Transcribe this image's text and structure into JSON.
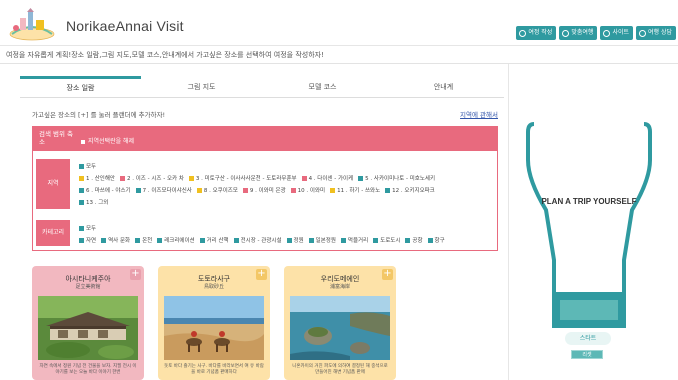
{
  "header": {
    "title": "NorikaeAnnai Visit",
    "buttons": [
      {
        "label": "여정 작성",
        "icon": "pencil-icon"
      },
      {
        "label": "맞춤여행",
        "icon": "route-icon"
      },
      {
        "label": "사이트",
        "icon": "clock-icon"
      },
      {
        "label": "여행 상담",
        "icon": "book-icon"
      }
    ]
  },
  "description": "여정을 자유롭게 계획!장소 일람,그림 지도,모델 코스,안내계에서 가고싶은 장소를 선택하여 여정을 작성하자!",
  "tabs": [
    "장소 일람",
    "그림 지도",
    "모델 코스",
    "안내계"
  ],
  "instruction": "가고싶은 장소의 [+] 를 눌러 플랜더에 추가하자!",
  "map_link": "지역에 관해서",
  "filter": {
    "title": "검색 범위 축소",
    "clear": "지역선택란을 해제",
    "region_label": "지역",
    "category_label": "카테고리",
    "region_rows": [
      [
        {
          "label": "모두",
          "color": "#2f9aa0"
        }
      ],
      [
        {
          "label": "1 . 산인해안",
          "color": "#f0c020"
        },
        {
          "label": "2 . 이즈 - 시즈 - 오카 차",
          "color": "#e86a7e"
        },
        {
          "label": "3 . 미토구산 - 이사사사운천 - 도토라무훈부",
          "color": "#f0c020"
        },
        {
          "label": "4 . 다이센 - 가이케",
          "color": "#e86a7e"
        },
        {
          "label": "5 . 사카이미나토 - 미호노세키",
          "color": "#2f9aa0"
        }
      ],
      [
        {
          "label": "6 . 마쓰에 - 야스기",
          "color": "#2f9aa0"
        },
        {
          "label": "7 . 이즈모다이샤신사",
          "color": "#2f9aa0"
        },
        {
          "label": "8 . 오쿠이즈모",
          "color": "#f0c020"
        },
        {
          "label": "9 . 이와미 은광",
          "color": "#e86a7e"
        },
        {
          "label": "10 . 이와미",
          "color": "#e86a7e"
        },
        {
          "label": "11 . 하기 - 쓰와노",
          "color": "#f0c020"
        },
        {
          "label": "12 . 오키지오파크",
          "color": "#2f9aa0"
        }
      ],
      [
        {
          "label": "13 . 그외",
          "color": "#2f9aa0"
        }
      ]
    ],
    "category_rows": [
      [
        {
          "label": "모두",
          "color": "#2f9aa0"
        }
      ],
      [
        {
          "label": "자연",
          "color": "#2f9aa0"
        },
        {
          "label": "역사 문화",
          "color": "#2f9aa0"
        },
        {
          "label": "온천",
          "color": "#2f9aa0"
        },
        {
          "label": "레크리에이션",
          "color": "#2f9aa0"
        },
        {
          "label": "거리 산책",
          "color": "#2f9aa0"
        },
        {
          "label": "전시장 - 관광시설",
          "color": "#2f9aa0"
        },
        {
          "label": "정원",
          "color": "#2f9aa0"
        },
        {
          "label": "일본정원",
          "color": "#2f9aa0"
        },
        {
          "label": "먹을거리",
          "color": "#2f9aa0"
        },
        {
          "label": "도로도시",
          "color": "#2f9aa0"
        },
        {
          "label": "공항",
          "color": "#2f9aa0"
        },
        {
          "label": "항구",
          "color": "#2f9aa0"
        }
      ]
    ]
  },
  "cards": [
    {
      "title": "아시타니케주아",
      "subtitle": "足立美術館",
      "text": "자연 속에서 정원 기념 전 건물을 보자. 지필 전시 이야기를 보는 오늘 바다 이야기 한번",
      "color": "#f2b8c0",
      "plus_color": "#e9a0ad"
    },
    {
      "title": "도토라사구",
      "subtitle": "鳥取砂丘",
      "text": "돗토 바다 즐기는 사구. 바다를 바라보면서 여 유 바람을 바로 기념품 판매하다",
      "color": "#fde2a8",
      "plus_color": "#f3c766"
    },
    {
      "title": "우리도메에인",
      "subtitle": "浦富海岸",
      "text": "니혼카이의 거친 파도에 의하여 결정된 해 중석으로 만들어진 해변 기념품 판매",
      "color": "#fde2a8",
      "plus_color": "#f3c766"
    }
  ],
  "side": {
    "plan_text": "PLAN A TRIP YOURSELF",
    "start_label": "스타트",
    "reset_label": "리셋"
  }
}
